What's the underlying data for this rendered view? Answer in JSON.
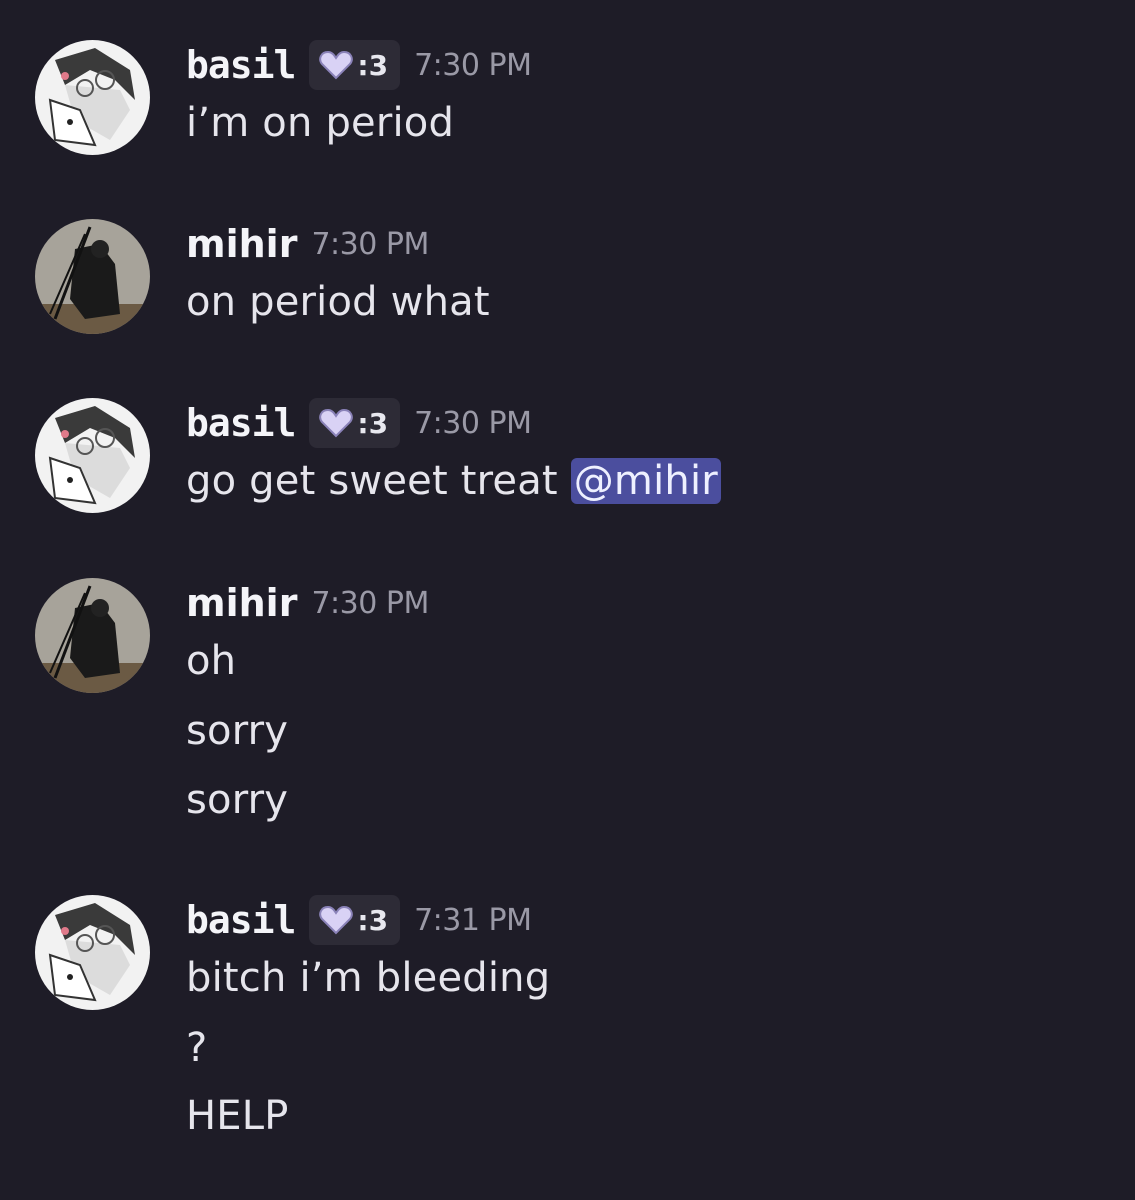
{
  "messages": [
    {
      "author": "basil",
      "tag": ":3",
      "tag_icon": "heart-icon",
      "time": "7:30 PM",
      "lines": [
        "i’m on period"
      ]
    },
    {
      "author": "mihir",
      "time": "7:30 PM",
      "lines": [
        "on period what"
      ]
    },
    {
      "author": "basil",
      "tag": ":3",
      "tag_icon": "heart-icon",
      "time": "7:30 PM",
      "lines": [
        "go get sweet treat "
      ],
      "mention": "@mihir"
    },
    {
      "author": "mihir",
      "time": "7:30 PM",
      "lines": [
        "oh",
        "sorry",
        "sorry"
      ]
    },
    {
      "author": "basil",
      "tag": ":3",
      "tag_icon": "heart-icon",
      "time": "7:31 PM",
      "lines": [
        "bitch i’m bleeding",
        "?",
        "HELP"
      ]
    }
  ],
  "colors": {
    "background": "#1e1c27",
    "mention_bg": "#4b4e9e",
    "tag_bg": "#2d2b36",
    "heart": "#d9d2f5"
  }
}
